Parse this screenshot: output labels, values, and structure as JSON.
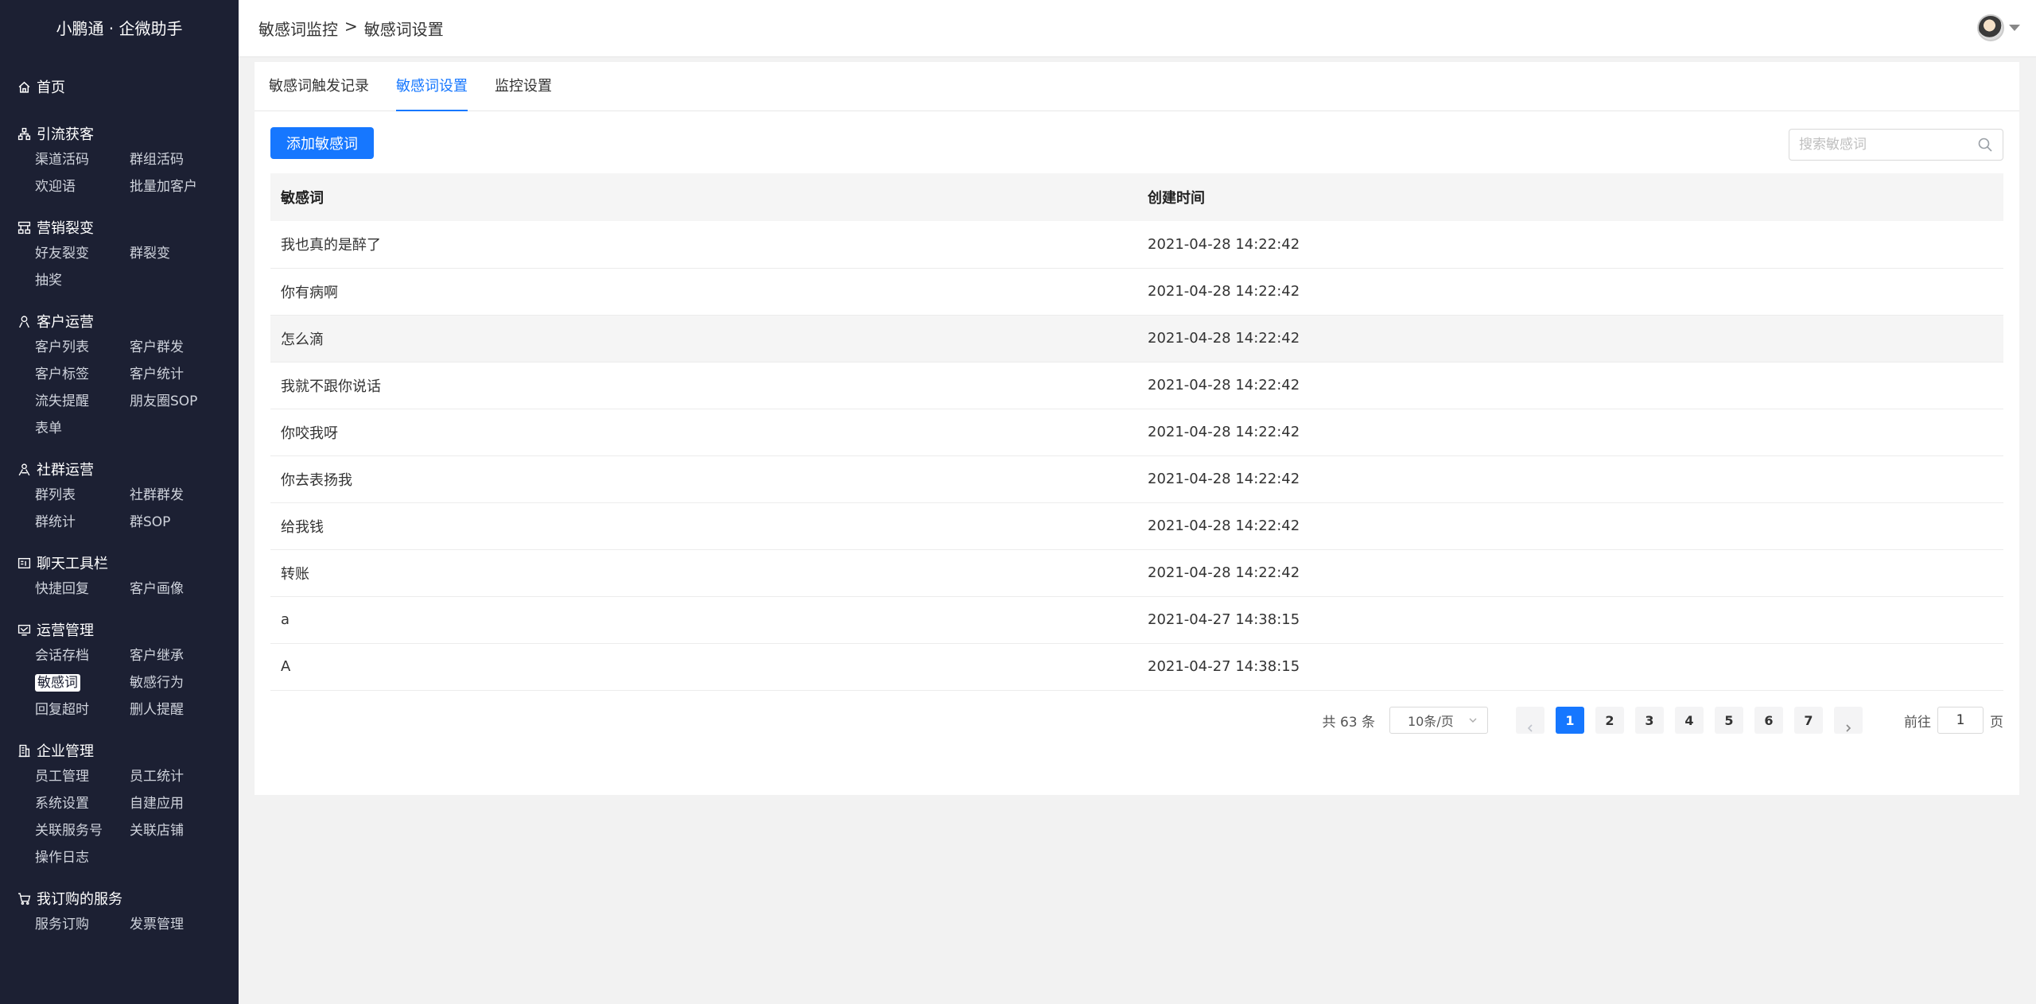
{
  "brand": "小鹏通 · 企微助手",
  "nav": {
    "home": "首页",
    "groups": [
      {
        "title": "引流获客",
        "icon": "network-icon",
        "items": [
          "渠道活码",
          "群组活码",
          "欢迎语",
          "批量加客户"
        ]
      },
      {
        "title": "营销裂变",
        "icon": "fission-icon",
        "items": [
          "好友裂变",
          "群裂变",
          "抽奖"
        ]
      },
      {
        "title": "客户运营",
        "icon": "user-icon",
        "items": [
          "客户列表",
          "客户群发",
          "客户标签",
          "客户统计",
          "流失提醒",
          "朋友圈SOP",
          "表单"
        ]
      },
      {
        "title": "社群运营",
        "icon": "community-icon",
        "items": [
          "群列表",
          "社群群发",
          "群统计",
          "群SOP"
        ]
      },
      {
        "title": "聊天工具栏",
        "icon": "toolbar-icon",
        "items": [
          "快捷回复",
          "客户画像"
        ]
      },
      {
        "title": "运营管理",
        "icon": "monitor-icon",
        "items": [
          "会话存档",
          "客户继承",
          "敏感词",
          "敏感行为",
          "回复超时",
          "删人提醒"
        ]
      },
      {
        "title": "企业管理",
        "icon": "building-icon",
        "items": [
          "员工管理",
          "员工统计",
          "系统设置",
          "自建应用",
          "关联服务号",
          "关联店铺",
          "操作日志"
        ]
      },
      {
        "title": "我订购的服务",
        "icon": "cart-icon",
        "items": [
          "服务订购",
          "发票管理"
        ]
      }
    ],
    "active_item": "敏感词"
  },
  "header": {
    "breadcrumb": [
      "敏感词监控",
      ">",
      "敏感词设置"
    ]
  },
  "tabs": [
    {
      "label": "敏感词触发记录",
      "active": false
    },
    {
      "label": "敏感词设置",
      "active": true
    },
    {
      "label": "监控设置",
      "active": false
    }
  ],
  "toolbar": {
    "add_label": "添加敏感词",
    "search_placeholder": "搜索敏感词",
    "search_value": ""
  },
  "table": {
    "columns": [
      "敏感词",
      "创建时间"
    ],
    "rows": [
      {
        "word": "我也真的是醉了",
        "time": "2021-04-28 14:22:42"
      },
      {
        "word": "你有病啊",
        "time": "2021-04-28 14:22:42"
      },
      {
        "word": "怎么滴",
        "time": "2021-04-28 14:22:42"
      },
      {
        "word": "我就不跟你说话",
        "time": "2021-04-28 14:22:42"
      },
      {
        "word": "你咬我呀",
        "time": "2021-04-28 14:22:42"
      },
      {
        "word": "你去表扬我",
        "time": "2021-04-28 14:22:42"
      },
      {
        "word": "给我钱",
        "time": "2021-04-28 14:22:42"
      },
      {
        "word": "转账",
        "time": "2021-04-28 14:22:42"
      },
      {
        "word": "a",
        "time": "2021-04-27 14:38:15"
      },
      {
        "word": "A",
        "time": "2021-04-27 14:38:15"
      }
    ],
    "hover_row": 2
  },
  "pagination": {
    "total": "共 63 条",
    "page_size": "10条/页",
    "pages": [
      "1",
      "2",
      "3",
      "4",
      "5",
      "6",
      "7"
    ],
    "current": "1",
    "goto_label": "前往",
    "goto_value": "1",
    "page_suffix": "页"
  },
  "colors": {
    "sidebar_bg": "#1c2033",
    "accent": "#1677ff"
  }
}
